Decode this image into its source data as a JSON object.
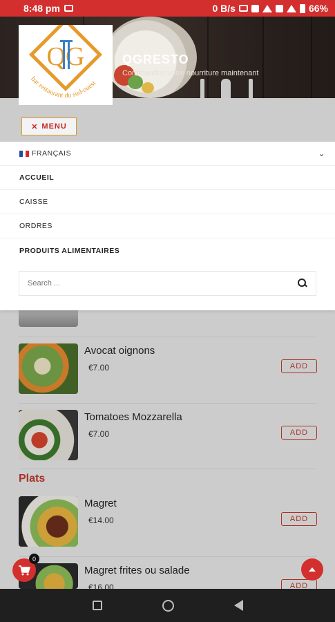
{
  "status": {
    "time": "8:48 pm",
    "net": "0 B/s",
    "battery": "66%"
  },
  "brand": {
    "name": "QGRESTO",
    "tagline": "Commandez votre nourriture maintenant",
    "logo_text": "bar restaurant du sud-ouest",
    "logo_letters": "QG"
  },
  "menu": {
    "toggle_label": "MENU",
    "language": "FRANÇAIS",
    "items": [
      {
        "label": "ACCUEIL"
      },
      {
        "label": "CAISSE"
      },
      {
        "label": "ORDRES"
      },
      {
        "label": "PRODUITS ALIMENTAIRES"
      }
    ],
    "search_placeholder": "Search ..."
  },
  "products": [
    {
      "name": "Avocat oignons",
      "price": "€7.00",
      "add": "ADD"
    },
    {
      "name": "Tomatoes Mozzarella",
      "price": "€7.00",
      "add": "ADD"
    },
    {
      "name": "Magret",
      "price": "€14.00",
      "add": "ADD"
    },
    {
      "name": "Magret frites ou salade",
      "price": "€16.00",
      "add": "ADD"
    }
  ],
  "category": {
    "plats": "Plats"
  },
  "cart": {
    "count": "0"
  },
  "colors": {
    "accent": "#d32f2f",
    "logo_orange": "#e59a2a",
    "logo_blue": "#3b7fc4"
  }
}
